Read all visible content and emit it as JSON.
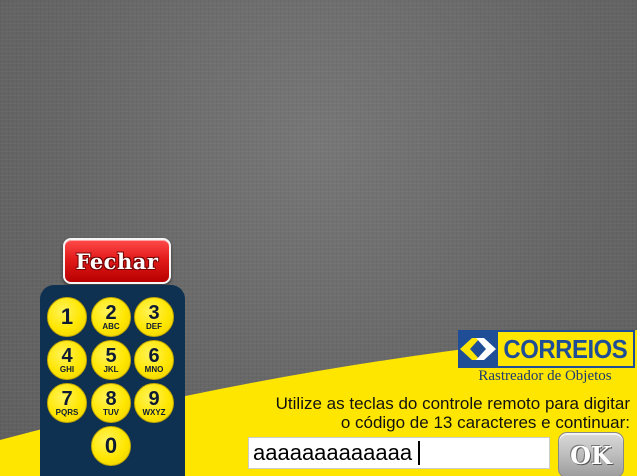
{
  "fechar_button": {
    "label": "Fechar"
  },
  "keypad": {
    "keys": [
      {
        "num": "1",
        "letters": ""
      },
      {
        "num": "2",
        "letters": "ABC"
      },
      {
        "num": "3",
        "letters": "DEF"
      },
      {
        "num": "4",
        "letters": "GHI"
      },
      {
        "num": "5",
        "letters": "JKL"
      },
      {
        "num": "6",
        "letters": "MNO"
      },
      {
        "num": "7",
        "letters": "PQRS"
      },
      {
        "num": "8",
        "letters": "TUV"
      },
      {
        "num": "9",
        "letters": "WXYZ"
      },
      {
        "num": "0",
        "letters": ""
      }
    ]
  },
  "logo": {
    "wordmark": "CORREIOS",
    "tagline": "Rastreador de Objetos"
  },
  "instructions": {
    "line1": "Utilize as teclas do controle remoto para digitar",
    "line2": "o código de 13 caracteres e continuar:"
  },
  "code_input": {
    "value": "aaaaaaaaaaaaa"
  },
  "ok_button": {
    "label": "OK"
  },
  "colors": {
    "yellow": "#ffe600",
    "navy": "#0e3151",
    "red": "#e31b1b",
    "brand_blue": "#1f4e96"
  }
}
